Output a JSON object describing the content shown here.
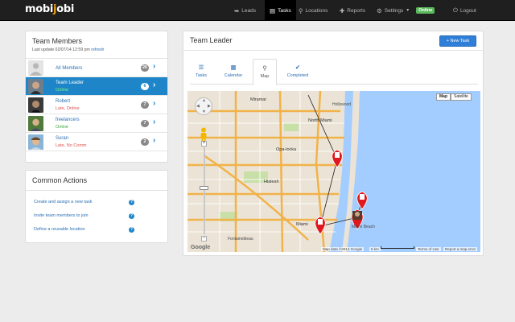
{
  "brand": {
    "name_part1": "mobi",
    "name_dot": "j",
    "name_part2": "obi"
  },
  "nav": {
    "leads": "Leads",
    "tasks": "Tasks",
    "locations": "Locations",
    "reports": "Reports",
    "settings": "Settings",
    "status_badge": "Online",
    "logout": "Logout"
  },
  "team_members": {
    "title": "Team Members",
    "last_update_label": "Last update 02/07/14 12:59 pm",
    "refresh_label": "refresh",
    "members": [
      {
        "name": "All Members",
        "status": "",
        "count": "26"
      },
      {
        "name": "Team Leader",
        "status": "Online",
        "count": "6"
      },
      {
        "name": "Robert",
        "status": "Late, Online",
        "count": "7"
      },
      {
        "name": "freelancers",
        "status": "Online",
        "count": "7"
      },
      {
        "name": "Suran",
        "status": "Late, No Comm",
        "count": "2"
      }
    ]
  },
  "common_actions": {
    "title": "Common Actions",
    "items": [
      "Create and assign a new task",
      "Invite team members to join",
      "Define a reusable location"
    ]
  },
  "team_leader": {
    "title": "Team Leader",
    "new_task_label": "+ New Task",
    "tabs": [
      {
        "label": "Tasks",
        "icon": "list-icon"
      },
      {
        "label": "Calendar",
        "icon": "calendar-icon"
      },
      {
        "label": "Map",
        "icon": "map-marker-icon"
      },
      {
        "label": "Completed",
        "icon": "checkmark-icon"
      }
    ],
    "active_tab": "Map"
  },
  "map": {
    "type_map_label": "Map",
    "type_satellite_label": "Satellite",
    "labels": {
      "miramar": "Miramar",
      "north_miami": "North Miami",
      "opa_locka": "Opa-locka",
      "hialeah": "Hialeah",
      "miami": "Miami",
      "fontainebleau": "Fontainebleau",
      "miami_beach": "Miami Beach",
      "hollywood": "Hollywood"
    },
    "attribution": "Map data ©2014 Google",
    "scale": "5 km",
    "terms": "Terms of Use",
    "report": "Report a map error",
    "logo": "Google",
    "colors": {
      "water": "#a3ccff",
      "land": "#ebe4d6",
      "highway": "#f2b24a",
      "marker": "#e0191f"
    }
  }
}
